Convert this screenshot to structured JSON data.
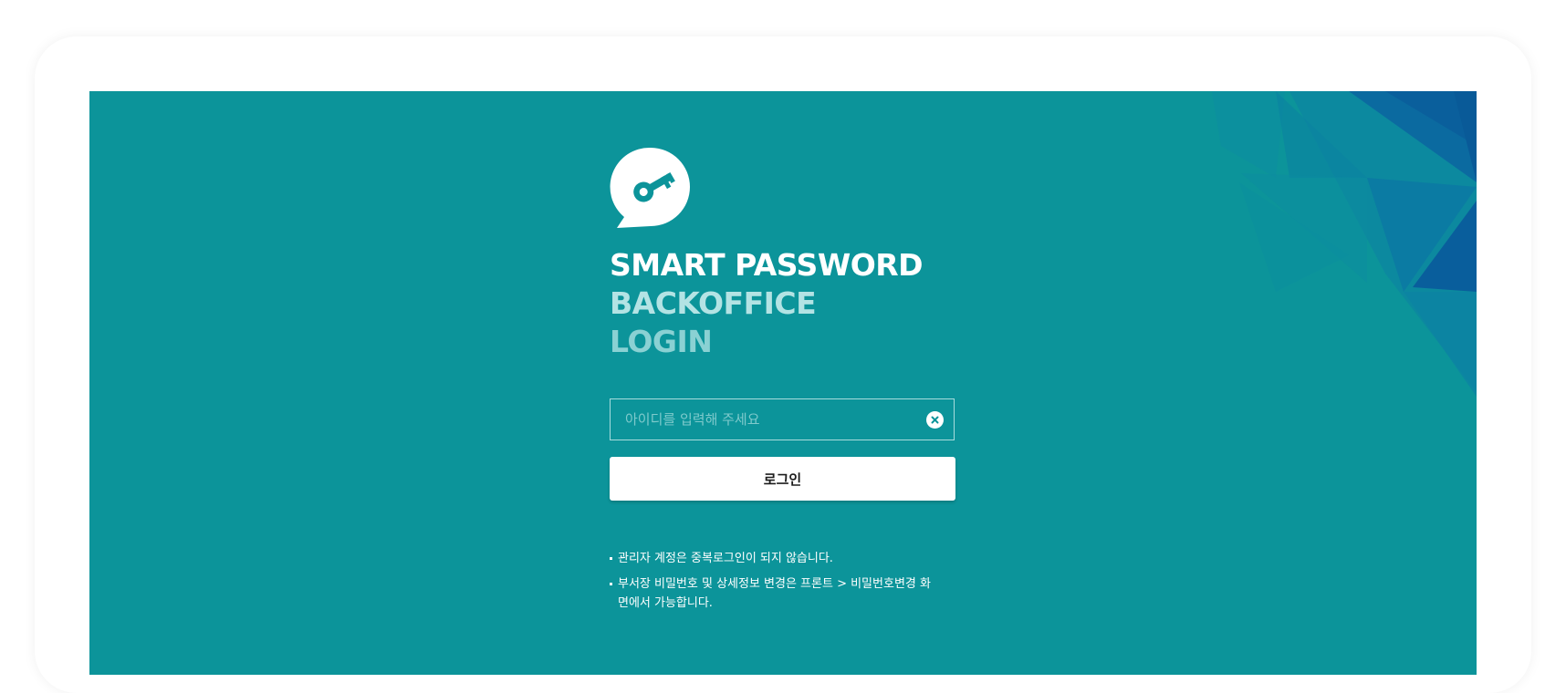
{
  "brand": {
    "title_line1": "SMART PASSWORD",
    "title_line2": "BACKOFFICE",
    "title_line3": "LOGIN",
    "logo_icon": "key-speech-bubble-icon"
  },
  "login_form": {
    "id_placeholder": "아이디를 입력해 주세요",
    "id_value": "",
    "clear_icon": "close-circle-icon",
    "login_button_label": "로그인"
  },
  "notices": [
    "관리자 계정은 중복로그인이 되지 않습니다.",
    "부서장 비밀번호 및 상세정보 변경은 프론트 > 비밀번호변경 화면에서 가능합니다."
  ],
  "colors": {
    "panel_bg": "#0c949a",
    "title_primary": "#ffffff",
    "title_secondary": "#b3e3e4",
    "title_tertiary": "#8ad1d3",
    "decoration_blue": "#0a5f9c"
  }
}
